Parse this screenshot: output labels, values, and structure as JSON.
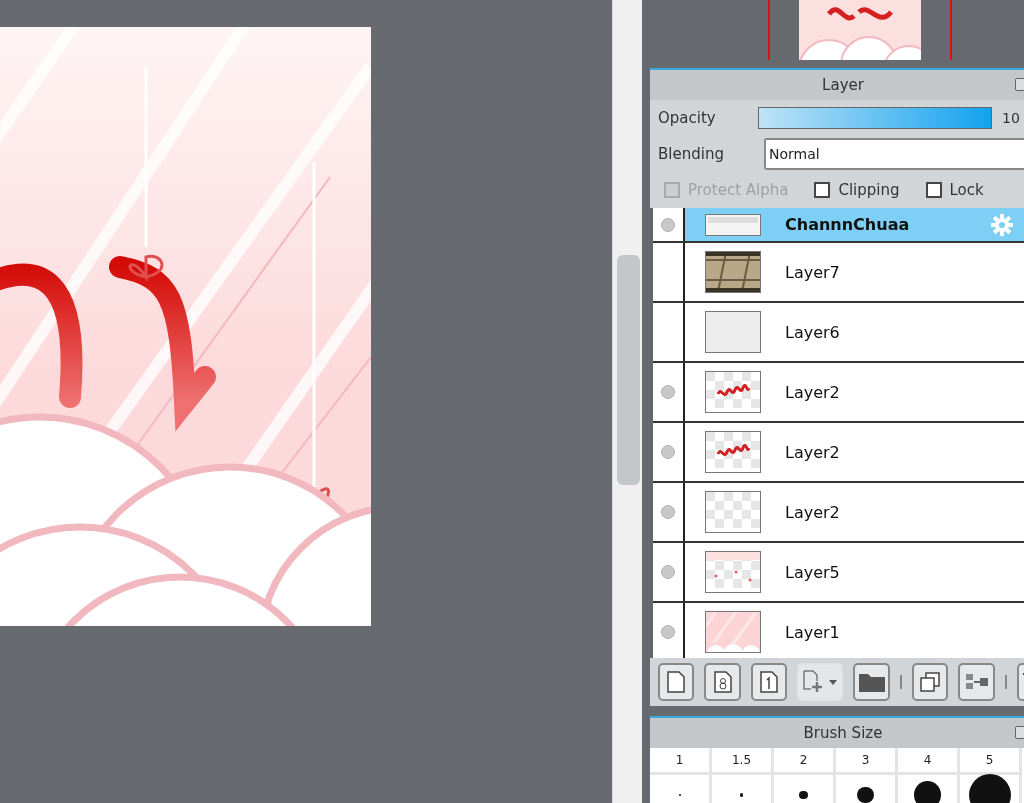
{
  "layer_panel": {
    "title": "Layer",
    "opacity": {
      "label": "Opacity",
      "level": 1,
      "reading": "10"
    },
    "blending": {
      "label": "Blending",
      "value": "Normal"
    },
    "options": [
      {
        "label": "Protect Alpha",
        "checked": false,
        "disabled": true
      },
      {
        "label": "Clipping",
        "checked": false,
        "disabled": false
      },
      {
        "label": "Lock",
        "checked": false,
        "disabled": false
      }
    ],
    "layers": [
      {
        "name": "ChannnChuaa",
        "visible": true,
        "selected": true,
        "kind": "text"
      },
      {
        "name": "Layer7",
        "visible": false,
        "selected": false,
        "kind": "photo"
      },
      {
        "name": "Layer6",
        "visible": false,
        "selected": false,
        "kind": "plain"
      },
      {
        "name": "Layer2",
        "visible": true,
        "selected": false,
        "kind": "lettering"
      },
      {
        "name": "Layer2",
        "visible": true,
        "selected": false,
        "kind": "lettering"
      },
      {
        "name": "Layer2",
        "visible": true,
        "selected": false,
        "kind": "transparent"
      },
      {
        "name": "Layer5",
        "visible": true,
        "selected": false,
        "kind": "hearts"
      },
      {
        "name": "Layer1",
        "visible": true,
        "selected": false,
        "kind": "background"
      }
    ]
  },
  "brush_panel": {
    "title": "Brush Size",
    "sizes": [
      "1",
      "1.5",
      "2",
      "3",
      "4",
      "5"
    ]
  }
}
